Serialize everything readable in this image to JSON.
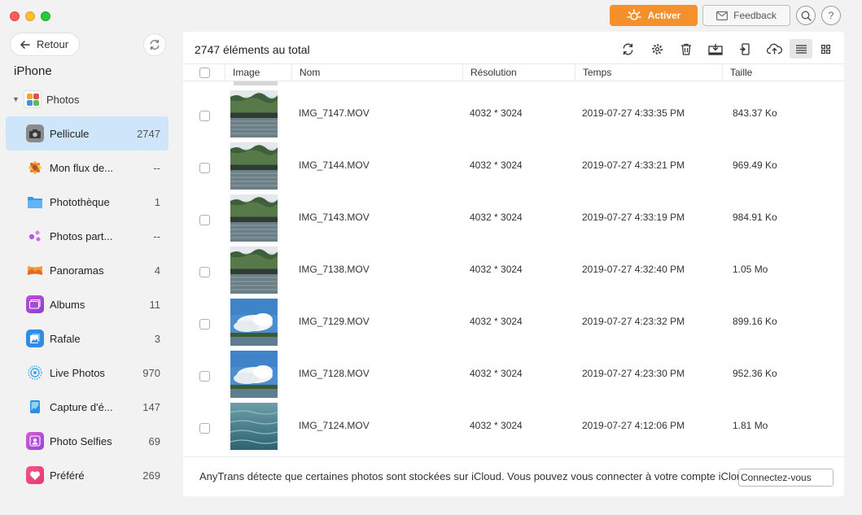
{
  "window": {
    "activate_label": "Activer",
    "feedback_label": "Feedback",
    "help_label": "?"
  },
  "sidebar": {
    "back_label": "Retour",
    "device_name": "iPhone",
    "group_label": "Photos",
    "items": [
      {
        "label": "Pellicule",
        "count": "2747",
        "icon": "camera-icon"
      },
      {
        "label": "Mon flux de...",
        "count": "--",
        "icon": "photostream-icon"
      },
      {
        "label": "Photothèque",
        "count": "1",
        "icon": "folder-icon"
      },
      {
        "label": "Photos part...",
        "count": "--",
        "icon": "shared-photos-icon"
      },
      {
        "label": "Panoramas",
        "count": "4",
        "icon": "panorama-icon"
      },
      {
        "label": "Albums",
        "count": "11",
        "icon": "albums-icon"
      },
      {
        "label": "Rafale",
        "count": "3",
        "icon": "burst-icon"
      },
      {
        "label": "Live Photos",
        "count": "970",
        "icon": "live-photos-icon"
      },
      {
        "label": "Capture d'é...",
        "count": "147",
        "icon": "screenshot-icon"
      },
      {
        "label": "Photo Selfies",
        "count": "69",
        "icon": "selfie-icon"
      },
      {
        "label": "Préféré",
        "count": "269",
        "icon": "heart-icon"
      }
    ]
  },
  "main": {
    "total_label": "2747 éléments au total",
    "columns": {
      "image": "Image",
      "name": "Nom",
      "resolution": "Résolution",
      "time": "Temps",
      "size": "Taille"
    },
    "rows": [
      {
        "name": "IMG_7147.MOV",
        "resolution": "4032 * 3024",
        "time": "2019-07-27 4:33:35 PM",
        "size": "843.37 Ko",
        "thumb": "lake"
      },
      {
        "name": "IMG_7144.MOV",
        "resolution": "4032 * 3024",
        "time": "2019-07-27 4:33:21 PM",
        "size": "969.49 Ko",
        "thumb": "lake"
      },
      {
        "name": "IMG_7143.MOV",
        "resolution": "4032 * 3024",
        "time": "2019-07-27 4:33:19 PM",
        "size": "984.91 Ko",
        "thumb": "lake"
      },
      {
        "name": "IMG_7138.MOV",
        "resolution": "4032 * 3024",
        "time": "2019-07-27 4:32:40 PM",
        "size": "1.05 Mo",
        "thumb": "lake"
      },
      {
        "name": "IMG_7129.MOV",
        "resolution": "4032 * 3024",
        "time": "2019-07-27 4:23:32 PM",
        "size": "899.16 Ko",
        "thumb": "sky"
      },
      {
        "name": "IMG_7128.MOV",
        "resolution": "4032 * 3024",
        "time": "2019-07-27 4:23:30 PM",
        "size": "952.36 Ko",
        "thumb": "sky"
      },
      {
        "name": "IMG_7124.MOV",
        "resolution": "4032 * 3024",
        "time": "2019-07-27 4:12:06 PM",
        "size": "1.81 Mo",
        "thumb": "water"
      }
    ],
    "footer_text": "AnyTrans détecte que certaines photos sont stockées sur iCloud. Vous pouvez vous connecter à votre compte iCloud",
    "connect_label": "Connectez-vous"
  },
  "colors": {
    "accent": "#f6902a",
    "selection": "#cfe5fa"
  }
}
